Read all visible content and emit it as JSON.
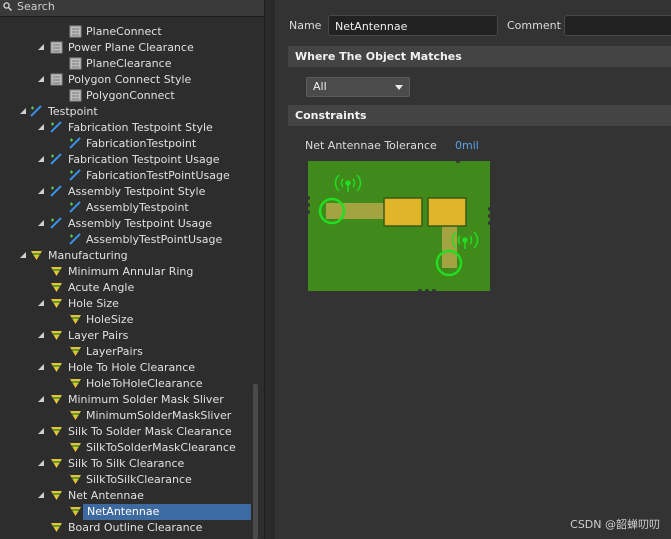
{
  "search": {
    "label": "Search"
  },
  "tree": [
    {
      "label": "PlaneConnect",
      "icon": "rule-instance-icon",
      "level": 2
    },
    {
      "label": "Power Plane Clearance",
      "icon": "rule-type-icon",
      "level": 1,
      "expanded": true
    },
    {
      "label": "PlaneClearance",
      "icon": "rule-instance-icon",
      "level": 2
    },
    {
      "label": "Polygon Connect Style",
      "icon": "rule-type-icon",
      "level": 1,
      "expanded": true
    },
    {
      "label": "PolygonConnect",
      "icon": "rule-instance-icon",
      "level": 2
    },
    {
      "label": "Testpoint",
      "icon": "testpoint-category-icon",
      "level": 0,
      "expanded": true
    },
    {
      "label": "Fabrication Testpoint Style",
      "icon": "testpoint-rule-icon",
      "level": 1,
      "expanded": true
    },
    {
      "label": "FabricationTestpoint",
      "icon": "testpoint-rule-icon",
      "level": 2
    },
    {
      "label": "Fabrication Testpoint Usage",
      "icon": "testpoint-rule-icon",
      "level": 1,
      "expanded": true
    },
    {
      "label": "FabricationTestPointUsage",
      "icon": "testpoint-rule-icon",
      "level": 2
    },
    {
      "label": "Assembly Testpoint Style",
      "icon": "testpoint-rule-icon",
      "level": 1,
      "expanded": true
    },
    {
      "label": "AssemblyTestpoint",
      "icon": "testpoint-rule-icon",
      "level": 2
    },
    {
      "label": "Assembly Testpoint Usage",
      "icon": "testpoint-rule-icon",
      "level": 1,
      "expanded": true
    },
    {
      "label": "AssemblyTestPointUsage",
      "icon": "testpoint-rule-icon",
      "level": 2
    },
    {
      "label": "Manufacturing",
      "icon": "manufacturing-category-icon",
      "level": 0,
      "expanded": true
    },
    {
      "label": "Minimum Annular Ring",
      "icon": "manufacturing-rule-icon",
      "level": 1,
      "expanded": false
    },
    {
      "label": "Acute Angle",
      "icon": "manufacturing-rule-icon",
      "level": 1,
      "expanded": false
    },
    {
      "label": "Hole Size",
      "icon": "manufacturing-rule-icon",
      "level": 1,
      "expanded": true
    },
    {
      "label": "HoleSize",
      "icon": "manufacturing-rule-icon",
      "level": 2
    },
    {
      "label": "Layer Pairs",
      "icon": "manufacturing-rule-icon",
      "level": 1,
      "expanded": true
    },
    {
      "label": "LayerPairs",
      "icon": "manufacturing-rule-icon",
      "level": 2
    },
    {
      "label": "Hole To Hole Clearance",
      "icon": "manufacturing-rule-icon",
      "level": 1,
      "expanded": true
    },
    {
      "label": "HoleToHoleClearance",
      "icon": "manufacturing-rule-icon",
      "level": 2
    },
    {
      "label": "Minimum Solder Mask Sliver",
      "icon": "manufacturing-rule-icon",
      "level": 1,
      "expanded": true
    },
    {
      "label": "MinimumSolderMaskSliver",
      "icon": "manufacturing-rule-icon",
      "level": 2
    },
    {
      "label": "Silk To Solder Mask Clearance",
      "icon": "manufacturing-rule-icon",
      "level": 1,
      "expanded": true
    },
    {
      "label": "SilkToSolderMaskClearance",
      "icon": "manufacturing-rule-icon",
      "level": 2
    },
    {
      "label": "Silk To Silk Clearance",
      "icon": "manufacturing-rule-icon",
      "level": 1,
      "expanded": true
    },
    {
      "label": "SilkToSilkClearance",
      "icon": "manufacturing-rule-icon",
      "level": 2
    },
    {
      "label": "Net Antennae",
      "icon": "manufacturing-rule-icon",
      "level": 1,
      "expanded": true
    },
    {
      "label": "NetAntennae",
      "icon": "manufacturing-rule-icon",
      "level": 2,
      "selected": true
    },
    {
      "label": "Board Outline Clearance",
      "icon": "manufacturing-rule-icon",
      "level": 1,
      "expanded": false
    }
  ],
  "form": {
    "name_label": "Name",
    "name_value": "NetAntennae",
    "comment_label": "Comment",
    "comment_value": ""
  },
  "where": {
    "header": "Where The Object Matches",
    "selected": "All"
  },
  "constraints": {
    "header": "Constraints",
    "tolerance_label": "Net Antennae Tolerance",
    "tolerance_value": "0mil"
  },
  "watermark": "CSDN @韶蝉叨叨",
  "colors": {
    "board": "#3f8a1a",
    "pad": "#e0b52a",
    "trace": "#a3a441",
    "highlight": "#22dd22",
    "tolerance": "#5aa0e8",
    "selection": "#3d6aa0"
  }
}
